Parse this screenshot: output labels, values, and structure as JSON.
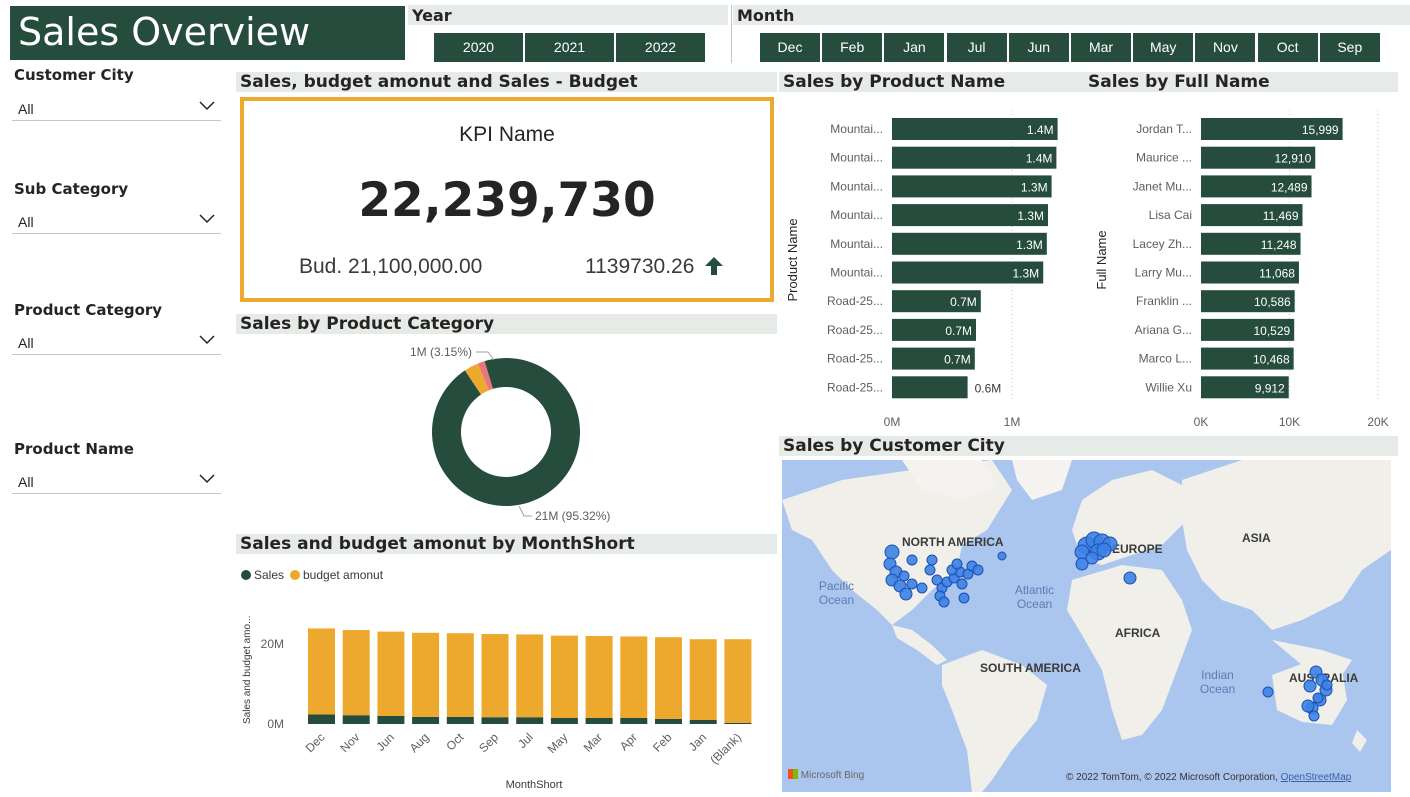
{
  "title": "Sales Overview",
  "slicers": {
    "customer_city": {
      "label": "Customer City",
      "value": "All"
    },
    "sub_category": {
      "label": "Sub Category",
      "value": "All"
    },
    "product_category": {
      "label": "Product Category",
      "value": "All"
    },
    "product_name": {
      "label": "Product Name",
      "value": "All"
    }
  },
  "year": {
    "label": "Year",
    "options": [
      "2020",
      "2021",
      "2022"
    ]
  },
  "month": {
    "label": "Month",
    "options": [
      "Dec",
      "Feb",
      "Jan",
      "Jul",
      "Jun",
      "Mar",
      "May",
      "Nov",
      "Oct",
      "Sep"
    ]
  },
  "kpi": {
    "header": "Sales, budget amonut and Sales - Budget",
    "name": "KPI Name",
    "value": "22,239,730",
    "budget": "Bud. 21,100,000.00",
    "diff": "1139730.26",
    "trend_icon": "arrow-up-icon",
    "accent": "#eda92e"
  },
  "colors": {
    "primary": "#254c3c",
    "accent": "#eda92e",
    "slice3": "#e8767b"
  },
  "chart_data": [
    {
      "id": "product_category",
      "type": "pie",
      "title": "Sales by Product Category",
      "slices": [
        {
          "value": 95.32,
          "label": "21M (95.32%)",
          "color": "#254c3c"
        },
        {
          "value": 3.15,
          "label": "1M (3.15%)",
          "color": "#eda92e"
        },
        {
          "value": 1.53,
          "label": "",
          "color": "#e8767b"
        }
      ]
    },
    {
      "id": "monthshort",
      "type": "bar",
      "title": "Sales and budget amonut by MonthShort",
      "legend": [
        "Sales",
        "budget amonut"
      ],
      "xlabel": "MonthShort",
      "ylabel": "Sales and budget amo...",
      "yticks": [
        "0M",
        "20M"
      ],
      "ylim": [
        0,
        25
      ],
      "categories": [
        "Dec",
        "Nov",
        "Jun",
        "Aug",
        "Oct",
        "Sep",
        "Jul",
        "May",
        "Mar",
        "Apr",
        "Feb",
        "Jan",
        "(Blank)"
      ],
      "series": [
        {
          "name": "Sales",
          "values": [
            2.4,
            2.2,
            2.0,
            1.8,
            1.8,
            1.7,
            1.7,
            1.5,
            1.5,
            1.5,
            1.3,
            1.0,
            0.3
          ]
        },
        {
          "name": "budget amonut",
          "values": [
            21.5,
            21.3,
            21.1,
            21.0,
            20.9,
            20.8,
            20.7,
            20.6,
            20.5,
            20.4,
            20.4,
            20.2,
            20.9
          ]
        }
      ]
    },
    {
      "id": "product_name",
      "type": "bar",
      "title": "Sales by Product Name",
      "ylabel": "Product Name",
      "xticks": [
        "0M",
        "1M"
      ],
      "xlim": [
        0,
        1.4
      ],
      "categories": [
        "Mountai...",
        "Mountai...",
        "Mountai...",
        "Mountai...",
        "Mountai...",
        "Mountai...",
        "Road-25...",
        "Road-25...",
        "Road-25...",
        "Road-25..."
      ],
      "values": [
        1.38,
        1.37,
        1.33,
        1.3,
        1.29,
        1.26,
        0.74,
        0.7,
        0.69,
        0.63
      ],
      "labels": [
        "1.4M",
        "1.4M",
        "1.3M",
        "1.3M",
        "1.3M",
        "1.3M",
        "0.7M",
        "0.7M",
        "0.7M",
        "0.6M"
      ]
    },
    {
      "id": "full_name",
      "type": "bar",
      "title": "Sales by Full Name",
      "ylabel": "Full Name",
      "xticks": [
        "0K",
        "10K",
        "20K"
      ],
      "xlim": [
        0,
        20000
      ],
      "categories": [
        "Jordan T...",
        "Maurice ...",
        "Janet Mu...",
        "Lisa Cai",
        "Lacey Zh...",
        "Larry Mu...",
        "Franklin ...",
        "Ariana G...",
        "Marco L...",
        "Willie Xu"
      ],
      "values": [
        15999,
        12910,
        12489,
        11469,
        11248,
        11068,
        10586,
        10529,
        10468,
        9912
      ],
      "labels": [
        "15,999",
        "12,910",
        "12,489",
        "11,469",
        "11,248",
        "11,068",
        "10,586",
        "10,529",
        "10,468",
        "9,912"
      ]
    }
  ],
  "map": {
    "title": "Sales by Customer City",
    "labels": [
      "NORTH AMERICA",
      "EUROPE",
      "ASIA",
      "AFRICA",
      "SOUTH AMERICA",
      "AUSTRALIA"
    ],
    "oceans": [
      "Pacific Ocean",
      "Atlantic Ocean",
      "Indian Ocean"
    ],
    "attribution": "© 2022 TomTom, © 2022 Microsoft Corporation,",
    "attribution_link": "OpenStreetMap",
    "logo": "Microsoft Bing"
  }
}
